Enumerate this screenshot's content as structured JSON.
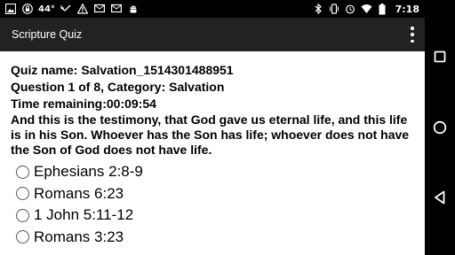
{
  "status_bar": {
    "temperature": "44°",
    "time": "7:18",
    "icons_left": [
      "picture-icon",
      "lock-icon",
      "missed-call-icon",
      "warning-icon",
      "message-icon",
      "message-icon",
      "android-icon"
    ],
    "icons_right": [
      "bluetooth-icon",
      "vibrate-icon",
      "alarm-icon",
      "wifi-icon",
      "battery-icon"
    ]
  },
  "app_bar": {
    "title": "Scripture Quiz",
    "menu_icon": "overflow-menu-icon"
  },
  "quiz": {
    "name_line": "Quiz name: Salvation_1514301488951",
    "question_line": "Question 1 of 8, Category: Salvation",
    "time_line": "Time remaining:00:09:54",
    "question_text": "And this is the testimony, that God gave us eternal life, and this life is in his Son. Whoever has the Son has life; whoever does not have the Son of God does not have life.",
    "options": [
      "Ephesians 2:8-9",
      "Romans 6:23",
      "1 John 5:11-12",
      "Romans 3:23"
    ]
  },
  "nav_bar": {
    "icons": [
      "recents-square-icon",
      "home-circle-icon",
      "back-triangle-icon"
    ]
  },
  "colors": {
    "status_bar": "#000000",
    "app_bar": "#222222",
    "background": "#ffffff",
    "radio_border": "#555555"
  }
}
